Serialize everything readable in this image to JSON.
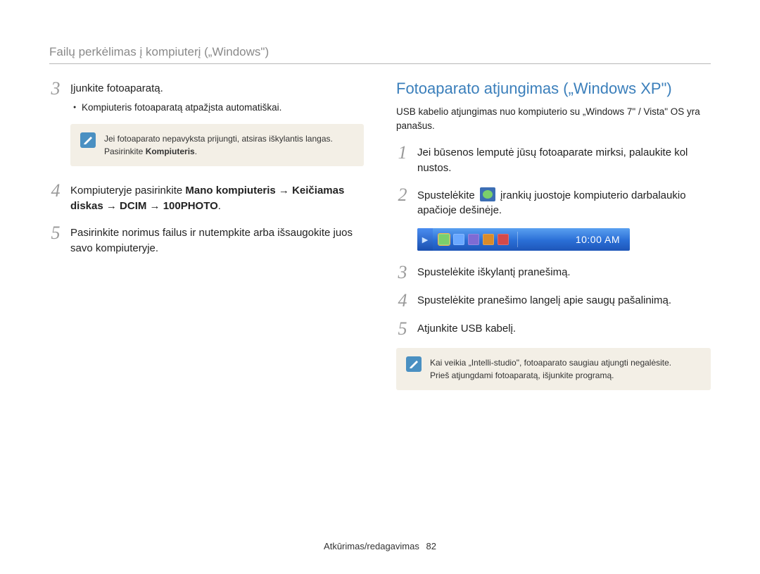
{
  "header": {
    "title": "Failų perkėlimas į kompiuterį („Windows\")"
  },
  "left": {
    "steps": [
      {
        "num": "3",
        "text": "Įjunkite fotoaparatą.",
        "sub": "Kompiuteris fotoaparatą atpažįsta automatiškai."
      },
      {
        "num": "4",
        "text_before": "Kompiuteryje pasirinkite ",
        "bold1": "Mano kompiuteris → Keičiamas diskas → DCIM → 100PHOTO",
        "text_after": "."
      },
      {
        "num": "5",
        "text": "Pasirinkite norimus failus ir nutempkite arba išsaugokite juos savo kompiuteryje."
      }
    ],
    "note": {
      "line1": "Jei fotoaparato nepavyksta prijungti, atsiras iškylantis langas.",
      "line2_prefix": "Pasirinkite ",
      "line2_bold": "Kompiuteris",
      "line2_suffix": "."
    }
  },
  "right": {
    "heading": "Fotoaparato atjungimas („Windows XP\")",
    "intro": "USB kabelio atjungimas nuo kompiuterio su „Windows 7\" / Vista\" OS yra panašus.",
    "steps": [
      {
        "num": "1",
        "text": "Jei būsenos lemputė jūsų fotoaparate mirksi, palaukite kol nustos."
      },
      {
        "num": "2",
        "text_before": "Spustelėkite ",
        "text_after": " įrankių juostoje kompiuterio darbalaukio apačioje dešinėje."
      },
      {
        "num": "3",
        "text": "Spustelėkite iškylantį pranešimą."
      },
      {
        "num": "4",
        "text": "Spustelėkite pranešimo langelį apie saugų pašalinimą."
      },
      {
        "num": "5",
        "text": "Atjunkite USB kabelį."
      }
    ],
    "taskbar": {
      "time": "10:00 AM",
      "icon_colors": [
        "#7bcf6b",
        "#6aa8ff",
        "#7e6bd4",
        "#d98b2a",
        "#d44a4a"
      ]
    },
    "note": {
      "line1": "Kai veikia „Intelli-studio\", fotoaparato saugiau atjungti negalėsite.",
      "line2": "Prieš atjungdami fotoaparatą, išjunkite programą."
    }
  },
  "footer": {
    "section": "Atkūrimas/redagavimas",
    "page": "82"
  }
}
